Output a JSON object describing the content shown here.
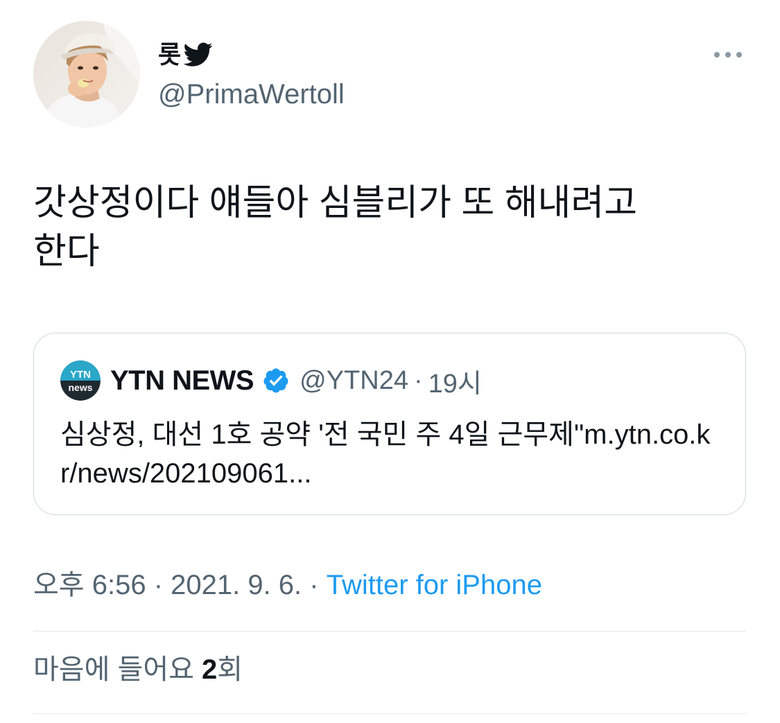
{
  "author": {
    "display_name": "롯",
    "badge_icon": "twitter-bird-icon",
    "handle": "@PrimaWertoll",
    "avatar": "profile-photo"
  },
  "more_icon": "more-horizontal-icon",
  "tweet": {
    "text": "갓상정이다 얘들아 심블리가 또 해내려고\n한다"
  },
  "quoted_tweet": {
    "avatar_text_top": "YTN",
    "avatar_text_bottom": "news",
    "display_name": "YTN NEWS",
    "verified_icon": "verified-badge-icon",
    "handle": "@YTN24",
    "separator": "·",
    "time": "19시",
    "text": "심상정, 대선 1호 공약 '전 국민 주 4일 근무제\"m.ytn.co.kr/news/202109061..."
  },
  "meta": {
    "time": "오후 6:56",
    "dot1": " · ",
    "date": "2021. 9. 6.",
    "dot2": " · ",
    "source": "Twitter for iPhone"
  },
  "likes": {
    "label": "마음에 들어요",
    "count": "2",
    "suffix": "회"
  },
  "colors": {
    "text": "#0f1419",
    "secondary": "#536471",
    "link": "#1d9bf0",
    "border": "#cfd9de",
    "verified": "#1d9bf0",
    "twitter_blue": "#1d9bf0"
  }
}
